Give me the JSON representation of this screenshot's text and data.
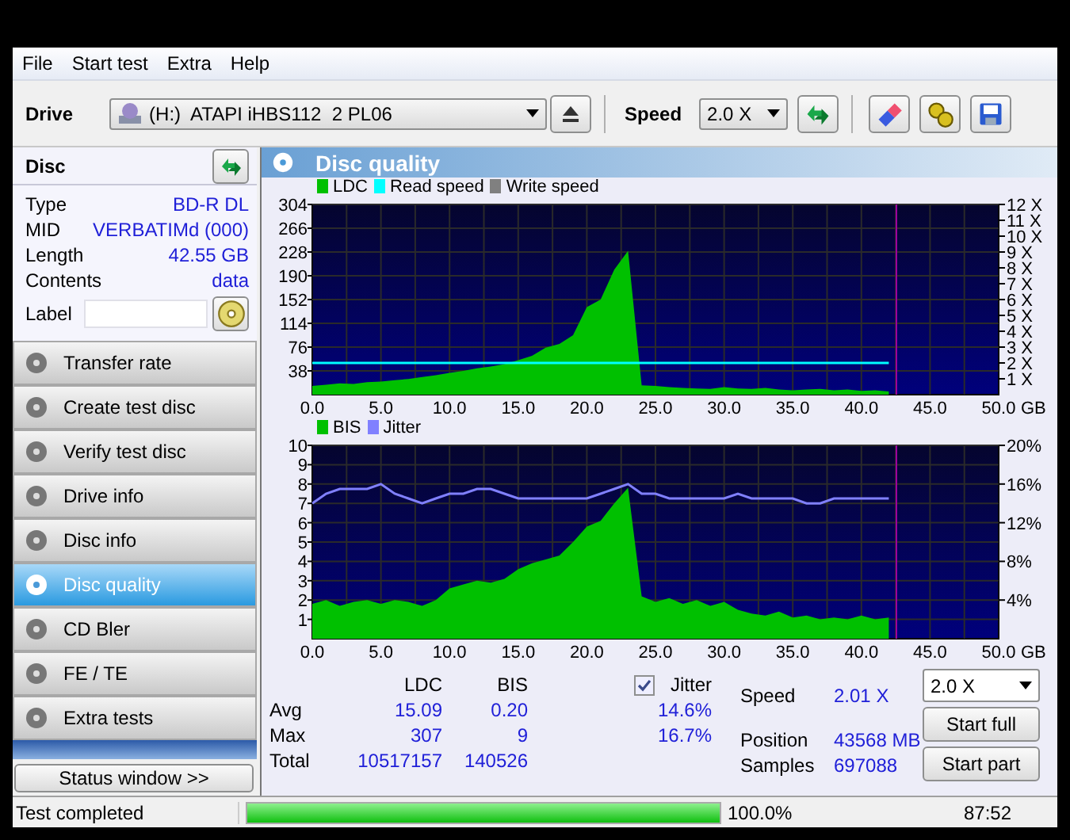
{
  "menu": [
    "File",
    "Start test",
    "Extra",
    "Help"
  ],
  "toolbar": {
    "drive_label": "Drive",
    "drive": "(H:)  ATAPI iHBS112  2 PL06",
    "speed_label": "Speed",
    "speed": "2.0 X"
  },
  "disc": {
    "title": "Disc",
    "info": [
      {
        "label": "Type",
        "value": "BD-R DL"
      },
      {
        "label": "MID",
        "value": "VERBATIMd (000)"
      },
      {
        "label": "Length",
        "value": "42.55 GB"
      },
      {
        "label": "Contents",
        "value": "data"
      }
    ],
    "label_field": {
      "label": "Label"
    }
  },
  "nav": [
    {
      "label": "Transfer rate",
      "selected": false
    },
    {
      "label": "Create test disc",
      "selected": false
    },
    {
      "label": "Verify test disc",
      "selected": false
    },
    {
      "label": "Drive info",
      "selected": false
    },
    {
      "label": "Disc info",
      "selected": false
    },
    {
      "label": "Disc quality",
      "selected": true
    },
    {
      "label": "CD Bler",
      "selected": false
    },
    {
      "label": "FE / TE",
      "selected": false
    },
    {
      "label": "Extra tests",
      "selected": false
    }
  ],
  "status_window_button": "Status window >>",
  "panel": {
    "title": "Disc quality",
    "charts": [
      {
        "chart_data": {
          "type": "area",
          "xlabel": "GB",
          "x": [
            0,
            1,
            2,
            3,
            4,
            5,
            6,
            7,
            8,
            9,
            10,
            11,
            12,
            13,
            14,
            15,
            16,
            17,
            18,
            19,
            20,
            21,
            22,
            23,
            24,
            25,
            26,
            27,
            28,
            29,
            30,
            31,
            32,
            33,
            34,
            35,
            36,
            37,
            38,
            39,
            40,
            41,
            42
          ],
          "xlim": [
            0,
            50
          ],
          "ylim": [
            0,
            304
          ],
          "y2lim": [
            0,
            12
          ],
          "xticks": [
            {
              "value": 0,
              "label": "0.0"
            },
            {
              "value": 5,
              "label": "5.0"
            },
            {
              "value": 10,
              "label": "10.0"
            },
            {
              "value": 15,
              "label": "15.0"
            },
            {
              "value": 20,
              "label": "20.0"
            },
            {
              "value": 25,
              "label": "25.0"
            },
            {
              "value": 30,
              "label": "30.0"
            },
            {
              "value": 35,
              "label": "35.0"
            },
            {
              "value": 40,
              "label": "40.0"
            },
            {
              "value": 45,
              "label": "45.0"
            },
            {
              "value": 50,
              "label": "50.0"
            }
          ],
          "yticks": [
            38,
            76,
            114,
            152,
            190,
            228,
            266,
            304
          ],
          "y2ticks": [
            {
              "value": 1,
              "label": "1 X"
            },
            {
              "value": 2,
              "label": "2 X"
            },
            {
              "value": 3,
              "label": "3 X"
            },
            {
              "value": 4,
              "label": "4 X"
            },
            {
              "value": 5,
              "label": "5 X"
            },
            {
              "value": 6,
              "label": "6 X"
            },
            {
              "value": 7,
              "label": "7 X"
            },
            {
              "value": 8,
              "label": "8 X"
            },
            {
              "value": 9,
              "label": "9 X"
            },
            {
              "value": 10,
              "label": "10 X"
            },
            {
              "value": 11,
              "label": "11 X"
            },
            {
              "value": 12,
              "label": "12 X"
            }
          ],
          "series": [
            {
              "name": "LDC",
              "color": "#00c000",
              "values": [
                14,
                16,
                18,
                17,
                20,
                21,
                23,
                25,
                28,
                31,
                35,
                38,
                42,
                45,
                49,
                55,
                62,
                75,
                81,
                95,
                140,
                152,
                200,
                230,
                15,
                14,
                12,
                11,
                10,
                9,
                12,
                10,
                9,
                11,
                8,
                7,
                8,
                9,
                7,
                8,
                6,
                7,
                5
              ]
            },
            {
              "name": "Read speed",
              "color": "#00ffff",
              "type": "line",
              "axis": "y2",
              "values": [
                2,
                2,
                2,
                2,
                2,
                2,
                2,
                2,
                2,
                2,
                2,
                2,
                2,
                2,
                2,
                2,
                2,
                2,
                2,
                2,
                2,
                2,
                2,
                2,
                2,
                2,
                2,
                2,
                2,
                2,
                2,
                2,
                2,
                2,
                2,
                2,
                2,
                2,
                2,
                2,
                2,
                2,
                2
              ]
            },
            {
              "name": "Write speed",
              "color": "#808080",
              "type": "line",
              "axis": "y2",
              "values": [
                null,
                null,
                null,
                null,
                null,
                null,
                null,
                null,
                null,
                null,
                null,
                null,
                null,
                null,
                null,
                null,
                null,
                null,
                null,
                null,
                null,
                null,
                null,
                null,
                null,
                null,
                null,
                null,
                null,
                null,
                null,
                null,
                null,
                null,
                null,
                null,
                null,
                null,
                null,
                null,
                null,
                null,
                null
              ]
            }
          ],
          "grid": true,
          "ref_lines": [
            {
              "axis": "x",
              "value": 42.55,
              "color": "#a000a0"
            }
          ]
        }
      },
      {
        "chart_data": {
          "type": "area",
          "xlabel": "GB",
          "x": [
            0,
            1,
            2,
            3,
            4,
            5,
            6,
            7,
            8,
            9,
            10,
            11,
            12,
            13,
            14,
            15,
            16,
            17,
            18,
            19,
            20,
            21,
            22,
            23,
            24,
            25,
            26,
            27,
            28,
            29,
            30,
            31,
            32,
            33,
            34,
            35,
            36,
            37,
            38,
            39,
            40,
            41,
            42
          ],
          "xlim": [
            0,
            50
          ],
          "ylim": [
            0,
            10
          ],
          "y2lim": [
            0,
            20
          ],
          "xticks": [
            {
              "value": 0,
              "label": "0.0"
            },
            {
              "value": 5,
              "label": "5.0"
            },
            {
              "value": 10,
              "label": "10.0"
            },
            {
              "value": 15,
              "label": "15.0"
            },
            {
              "value": 20,
              "label": "20.0"
            },
            {
              "value": 25,
              "label": "25.0"
            },
            {
              "value": 30,
              "label": "30.0"
            },
            {
              "value": 35,
              "label": "35.0"
            },
            {
              "value": 40,
              "label": "40.0"
            },
            {
              "value": 45,
              "label": "45.0"
            },
            {
              "value": 50,
              "label": "50.0"
            }
          ],
          "yticks": [
            1,
            2,
            3,
            4,
            5,
            6,
            7,
            8,
            9,
            10
          ],
          "y2ticks": [
            {
              "value": 4,
              "label": "4%"
            },
            {
              "value": 8,
              "label": "8%"
            },
            {
              "value": 12,
              "label": "12%"
            },
            {
              "value": 16,
              "label": "16%"
            },
            {
              "value": 20,
              "label": "20%"
            }
          ],
          "series": [
            {
              "name": "BIS",
              "color": "#00c000",
              "values": [
                1.8,
                2,
                1.7,
                1.9,
                2,
                1.8,
                2,
                1.9,
                1.7,
                2,
                2.6,
                2.8,
                3,
                2.9,
                3.1,
                3.6,
                3.9,
                4.1,
                4.3,
                5,
                5.8,
                6.1,
                7,
                7.8,
                2.2,
                1.9,
                2.1,
                1.8,
                2,
                1.7,
                1.9,
                1.5,
                1.3,
                1.2,
                1.4,
                1.1,
                1.2,
                1,
                1.1,
                1,
                1.2,
                1,
                1.1
              ]
            },
            {
              "name": "Jitter",
              "color": "#8080ff",
              "type": "line",
              "axis": "y2",
              "values": [
                14,
                15,
                15.5,
                15.5,
                15.5,
                16,
                15,
                14.5,
                14,
                14.5,
                15,
                15,
                15.5,
                15.5,
                15,
                14.5,
                14.5,
                14.5,
                14.5,
                14.5,
                14.5,
                15,
                15.5,
                16,
                15,
                15,
                14.5,
                14.5,
                14.5,
                14.5,
                14.5,
                15,
                14.5,
                14.5,
                14.5,
                14.5,
                14,
                14,
                14.5,
                14.5,
                14.5,
                14.5,
                14.5
              ]
            }
          ],
          "grid": true,
          "ref_lines": [
            {
              "axis": "x",
              "value": 42.55,
              "color": "#a000a0"
            }
          ]
        }
      }
    ],
    "stats": {
      "columns": [
        "LDC",
        "BIS"
      ],
      "jitter": {
        "label": "Jitter",
        "checked": true
      },
      "rows": [
        {
          "label": "Avg",
          "values": [
            "15.09",
            "0.20"
          ],
          "jitter": "14.6%"
        },
        {
          "label": "Max",
          "values": [
            "307",
            "9"
          ],
          "jitter": "16.7%"
        },
        {
          "label": "Total",
          "values": [
            "10517157",
            "140526"
          ]
        }
      ],
      "info": [
        {
          "label": "Speed",
          "value": "2.01 X"
        },
        {
          "label": "Position",
          "value": "43568 MB"
        },
        {
          "label": "Samples",
          "value": "697088"
        }
      ],
      "speed": "2.0 X",
      "buttons": [
        "Start full",
        "Start part"
      ]
    }
  },
  "status_bar": {
    "message": "Test completed",
    "progress": {
      "level": 1.0
    },
    "percent": "100.0%",
    "time": "87:52"
  }
}
